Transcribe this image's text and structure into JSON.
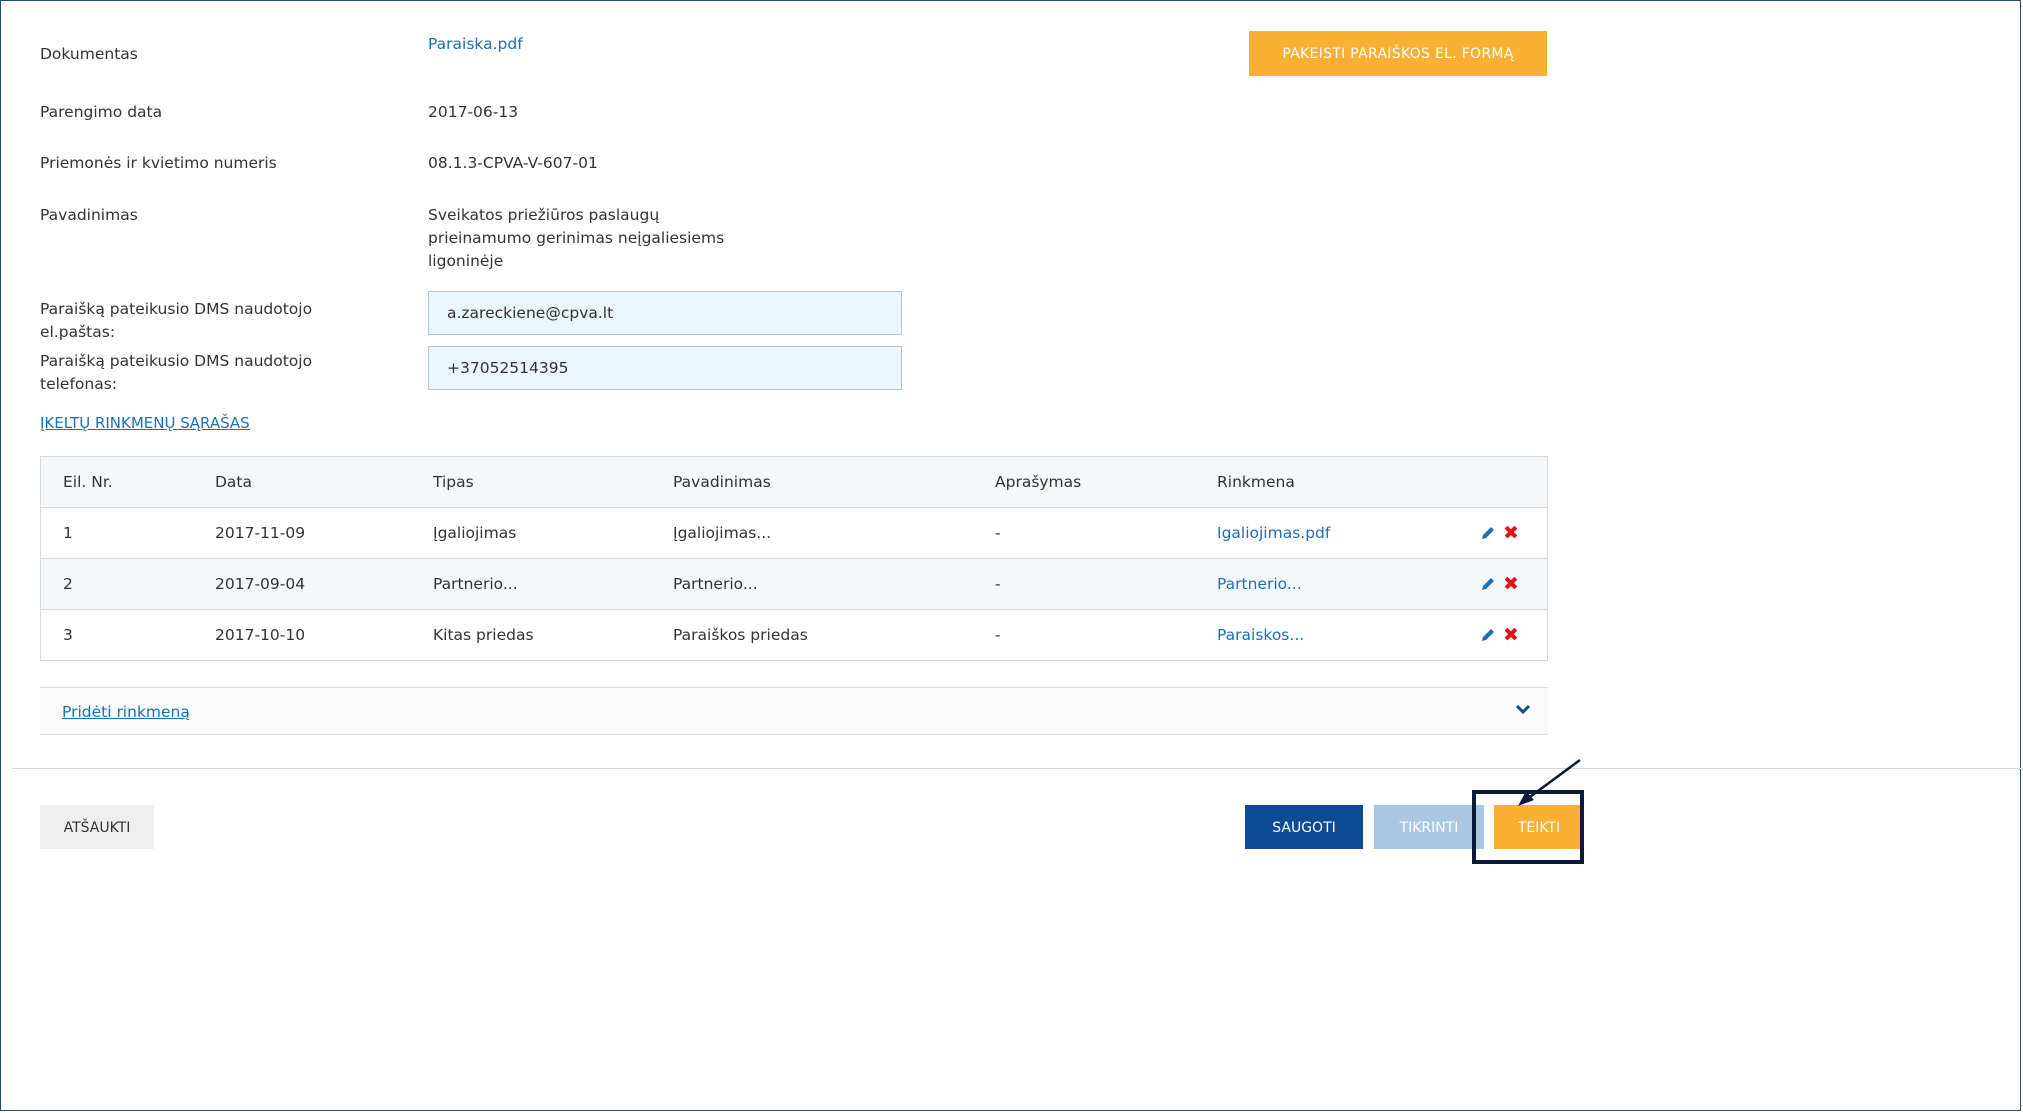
{
  "top_button": "PAKEISTI PARAIŠKOS EL. FORMĄ",
  "info": {
    "document_label": "Dokumentas",
    "document_value": "Paraiska.pdf",
    "date_label": "Parengimo data",
    "date_value": "2017-06-13",
    "measure_label": "Priemonės ir kvietimo numeris",
    "measure_value": "08.1.3-CPVA-V-607-01",
    "name_label": "Pavadinimas",
    "name_line1": "Sveikatos priežiūros paslaugų",
    "name_line2": "prieinamumo gerinimas neįgaliesiems",
    "name_line3": "ligoninėje",
    "email_label_1": "Paraišką pateikusio DMS naudotojo",
    "email_label_2": "el.paštas:",
    "email_value": "a.zareckiene@cpva.lt",
    "phone_label_1": "Paraišką pateikusio DMS naudotojo",
    "phone_label_2": "telefonas:",
    "phone_value": "+37052514395"
  },
  "files_section_title": "ĮKELTŲ RINKMENŲ SĄRAŠAS",
  "table": {
    "headers": [
      "Eil. Nr.",
      "Data",
      "Tipas",
      "Pavadinimas",
      "Aprašymas",
      "Rinkmena"
    ],
    "rows": [
      {
        "no": "1",
        "date": "2017-11-09",
        "type": "Įgaliojimas",
        "name": "Įgaliojimas...",
        "desc": "-",
        "file": "Igaliojimas.pdf"
      },
      {
        "no": "2",
        "date": "2017-09-04",
        "type": "Partnerio...",
        "name": "Partnerio...",
        "desc": "-",
        "file": "Partnerio..."
      },
      {
        "no": "3",
        "date": "2017-10-10",
        "type": "Kitas priedas",
        "name": "Paraiškos priedas",
        "desc": "-",
        "file": "Paraiskos..."
      }
    ]
  },
  "add_file_label": "Pridėti rinkmeną",
  "buttons": {
    "cancel": "ATŠAUKTI",
    "save": "SAUGOTI",
    "check": "TIKRINTI",
    "submit": "TEIKTI"
  },
  "colors": {
    "accent_orange": "#fbb034",
    "link_blue": "#1d6fb8",
    "primary_blue": "#0d4b97",
    "disabled_blue": "#a9c6e2",
    "delete_red": "#e21313"
  }
}
